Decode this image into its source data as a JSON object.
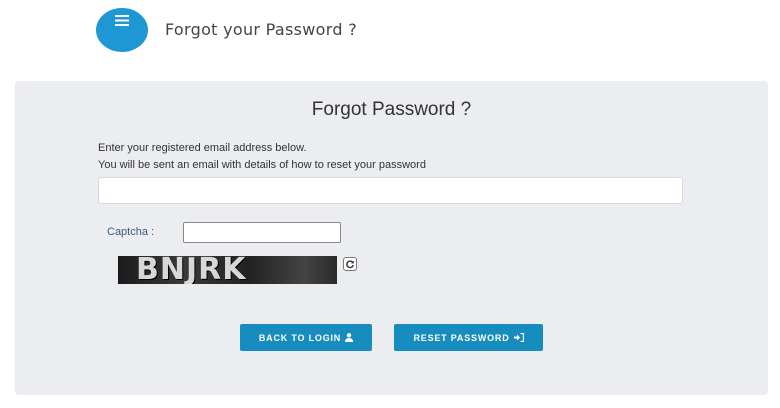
{
  "header": {
    "title": "Forgot your Password ?",
    "menu_icon": "hamburger-icon",
    "accent_color": "#1f97d4"
  },
  "card": {
    "title": "Forgot Password ?",
    "instruction_line1": "Enter your registered email address below.",
    "instruction_line2": "You will be sent an email with details of how to reset your password",
    "email_value": "",
    "captcha_label": "Captcha :",
    "captcha_value": "",
    "captcha_image_text": "BNJRK",
    "refresh_icon": "refresh-icon",
    "buttons": {
      "back_label": "BACK TO LOGIN",
      "back_icon": "user-icon",
      "reset_label": "RESET PASSWORD",
      "reset_icon": "sign-in-icon",
      "color": "#168cbf"
    }
  }
}
